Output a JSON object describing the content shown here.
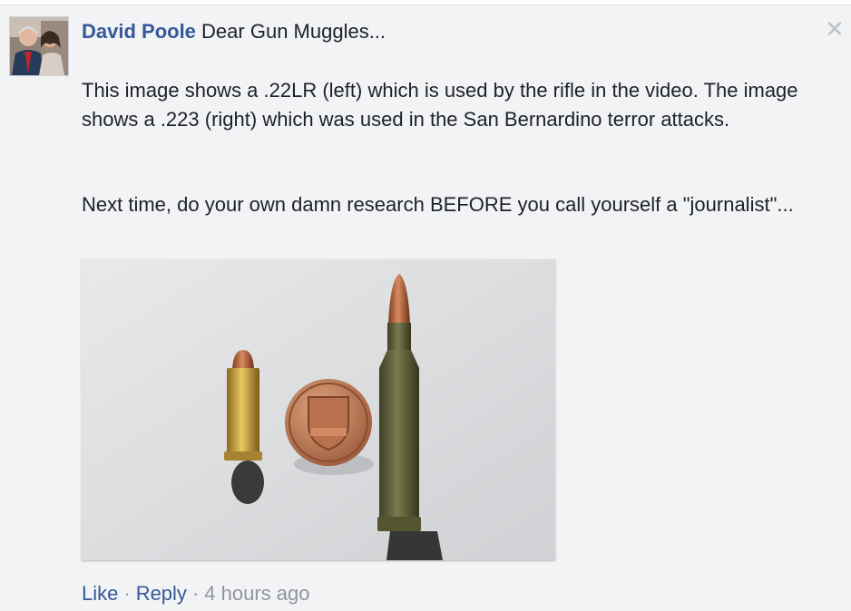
{
  "comment": {
    "author": "David Poole",
    "first_line": "Dear Gun Muggles...",
    "paragraph1": "This image shows a .22LR (left) which is used by the rifle in the video. The image shows a .223 (right) which was used in the San Bernardino terror attacks.",
    "paragraph2": "Next time, do your own damn research BEFORE you call yourself a \"journalist\"...",
    "image_alt": "A .22LR cartridge, a one-cent coin, and a .223 cartridge on a white surface",
    "actions": {
      "like": "Like",
      "separator": "·",
      "reply": "Reply",
      "timestamp": "4 hours ago"
    }
  },
  "icons": {
    "close": "close-icon",
    "avatar": "avatar"
  },
  "colors": {
    "link": "#365899",
    "muted": "#90949c",
    "background": "#f2f3f5"
  }
}
